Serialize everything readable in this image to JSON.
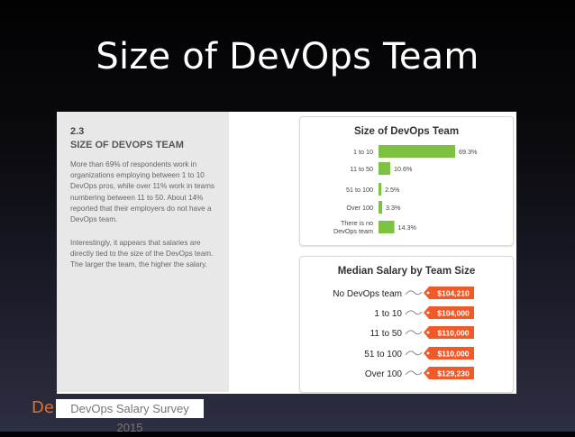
{
  "slide": {
    "title": "Size of DevOps Team",
    "footer_logo": "De",
    "footer_caption": "DevOps Salary Survey 2015"
  },
  "report": {
    "section_number": "2.3",
    "section_title": "SIZE OF DEVOPS TEAM",
    "paragraph1": "More than 69% of respondents work in organizations employing between 1 to 10 DevOps pros, while over 11% work in teams numbering between 11 to 50. About 14% reported that their employers do not have a DevOps team.",
    "paragraph2": "Interestingly, it appears that salaries are directly tied to the size of the DevOps team. The larger the team, the higher the salary."
  },
  "chart_data": [
    {
      "type": "bar",
      "title": "Size of DevOps Team",
      "categories": [
        "1 to 10",
        "11 to 50",
        "51 to 100",
        "Over 100",
        "There is no DevOps team"
      ],
      "values": [
        69.3,
        10.6,
        2.5,
        3.3,
        14.3
      ],
      "value_labels": [
        "69.3%",
        "10.6%",
        "2.5%",
        "3.3%",
        "14.3%"
      ],
      "bar_color": "#7dc242"
    },
    {
      "type": "table",
      "title": "Median Salary by Team Size",
      "categories": [
        "No DevOps team",
        "1 to 10",
        "11 to 50",
        "51 to 100",
        "Over 100"
      ],
      "values": [
        104210,
        104000,
        110000,
        110000,
        129230
      ],
      "value_labels": [
        "$104,210",
        "$104,000",
        "$110,000",
        "$110,000",
        "$129,230"
      ],
      "tag_color": "#f05a28"
    }
  ]
}
